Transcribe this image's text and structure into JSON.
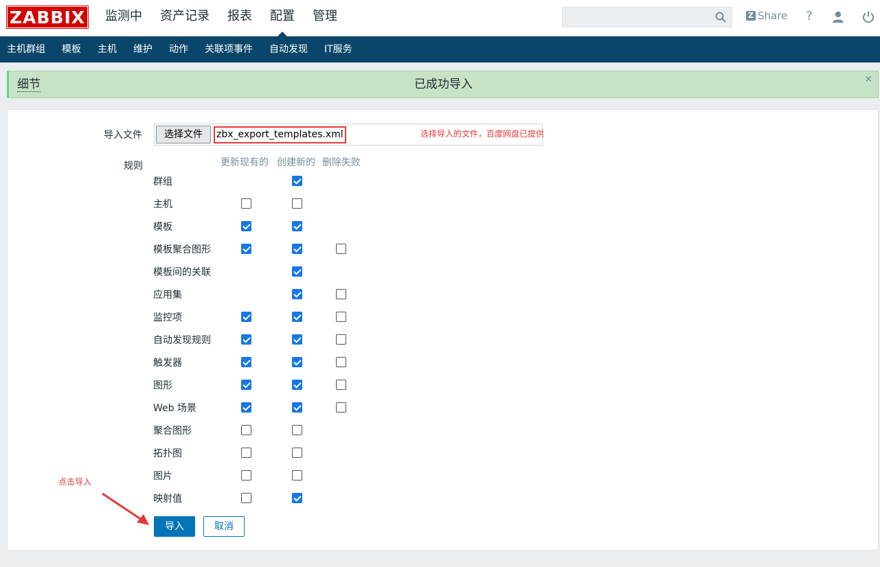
{
  "logo": "ZABBIX",
  "top_menu": [
    "监测中",
    "资产记录",
    "报表",
    "配置",
    "管理"
  ],
  "top_menu_active": "配置",
  "search": {
    "value": ""
  },
  "share_label": "Share",
  "help_label": "?",
  "sub_menu": [
    "主机群组",
    "模板",
    "主机",
    "维护",
    "动作",
    "关联项事件",
    "自动发现",
    "IT服务"
  ],
  "message": {
    "details_label": "细节",
    "text": "已成功导入"
  },
  "form": {
    "file_label": "导入文件",
    "file_button": "选择文件",
    "file_name": "zbx_export_templates.xml",
    "file_annotation": "选择导入的文件，百度网盘已提供",
    "rules_label": "规则",
    "col_update": "更新现有的",
    "col_create": "创建新的",
    "col_delete": "删除失败",
    "rows": [
      {
        "label": "群组",
        "update": null,
        "create": true,
        "delete": null
      },
      {
        "label": "主机",
        "update": false,
        "create": false,
        "delete": null
      },
      {
        "label": "模板",
        "update": true,
        "create": true,
        "delete": null
      },
      {
        "label": "模板聚合图形",
        "update": true,
        "create": true,
        "delete": false
      },
      {
        "label": "模板间的关联",
        "update": null,
        "create": true,
        "delete": null
      },
      {
        "label": "应用集",
        "update": null,
        "create": true,
        "delete": false
      },
      {
        "label": "监控项",
        "update": true,
        "create": true,
        "delete": false
      },
      {
        "label": "自动发现规则",
        "update": true,
        "create": true,
        "delete": false
      },
      {
        "label": "触发器",
        "update": true,
        "create": true,
        "delete": false
      },
      {
        "label": "图形",
        "update": true,
        "create": true,
        "delete": false
      },
      {
        "label": "Web 场景",
        "update": true,
        "create": true,
        "delete": false
      },
      {
        "label": "聚合图形",
        "update": false,
        "create": false,
        "delete": null
      },
      {
        "label": "拓扑图",
        "update": false,
        "create": false,
        "delete": null
      },
      {
        "label": "图片",
        "update": false,
        "create": false,
        "delete": null
      },
      {
        "label": "映射值",
        "update": false,
        "create": true,
        "delete": null
      }
    ],
    "import_annotation": "点击导入",
    "import_button": "导入",
    "cancel_button": "取消"
  },
  "colors": {
    "brand": "#d40000",
    "nav": "#0a466a",
    "success_bg": "#c7e3c5",
    "checkbox": "#1677e5",
    "annotation": "#e43a3a"
  }
}
